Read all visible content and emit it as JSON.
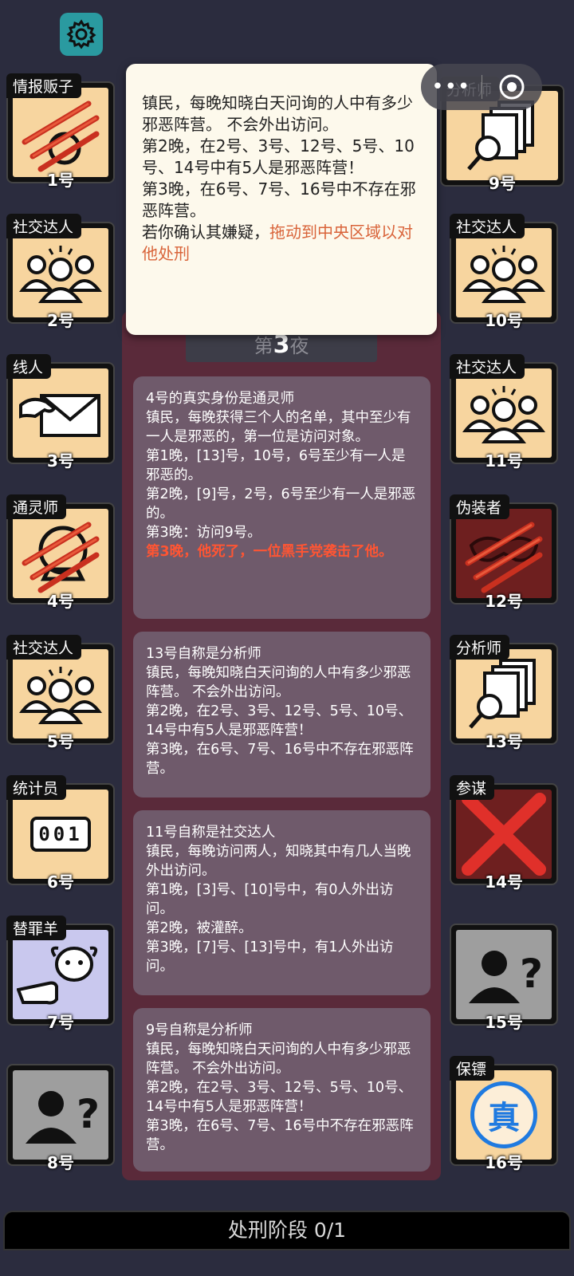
{
  "popup": {
    "text": "镇民，每晚知晓白天问询的人中有多少邪恶阵营。 不会外出访问。\n第2晚，在2号、3号、12号、5号、10号、14号中有5人是邪恶阵营！\n第3晚，在6号、7号、16号中不存在邪恶阵营。\n若你确认其嫌疑，",
    "highlight": "拖动到中央区域以对他处刑"
  },
  "night": {
    "prefix": "第",
    "num": "3",
    "suffix": "夜"
  },
  "cards": [
    {
      "role": "情报贩子",
      "num": "1号"
    },
    {
      "role": "社交达人",
      "num": "2号"
    },
    {
      "role": "线人",
      "num": "3号"
    },
    {
      "role": "通灵师",
      "num": "4号"
    },
    {
      "role": "社交达人",
      "num": "5号"
    },
    {
      "role": "统计员",
      "num": "6号"
    },
    {
      "role": "替罪羊",
      "num": "7号"
    },
    {
      "role": "",
      "num": "8号"
    },
    {
      "role": "分析师",
      "num": "9号"
    },
    {
      "role": "社交达人",
      "num": "10号"
    },
    {
      "role": "社交达人",
      "num": "11号"
    },
    {
      "role": "伪装者",
      "num": "12号"
    },
    {
      "role": "分析师",
      "num": "13号"
    },
    {
      "role": "参谋",
      "num": "14号"
    },
    {
      "role": "",
      "num": "15号"
    },
    {
      "role": "保镖",
      "num": "16号"
    }
  ],
  "logs": [
    {
      "text": "4号的真实身份是通灵师\n镇民，每晚获得三个人的名单，其中至少有一人是邪恶的，第一位是访问对象。\n第1晚，[13]号，10号，6号至少有一人是邪恶的。\n第2晚，[9]号，2号，6号至少有一人是邪恶的。\n第3晚：访问9号。",
      "red": "第3晚，他死了，一位黑手党袭击了他。"
    },
    {
      "text": "13号自称是分析师\n镇民，每晚知晓白天问询的人中有多少邪恶阵营。 不会外出访问。\n第2晚，在2号、3号、12号、5号、10号、14号中有5人是邪恶阵营！\n第3晚，在6号、7号、16号中不存在邪恶阵营。",
      "red": ""
    },
    {
      "text": "11号自称是社交达人\n镇民，每晚访问两人，知晓其中有几人当晚外出访问。\n第1晚，[3]号、[10]号中，有0人外出访问。\n第2晚，被灌醉。\n第3晚，[7]号、[13]号中，有1人外出访问。",
      "red": ""
    },
    {
      "text": "9号自称是分析师\n镇民，每晚知晓白天问询的人中有多少邪恶阵营。 不会外出访问。\n第2晚，在2号、3号、12号、5号、10号、14号中有5人是邪恶阵营！\n第3晚，在6号、7号、16号中不存在邪恶阵营。",
      "red": ""
    }
  ],
  "guard_badge": "真",
  "counter_digits": "001",
  "bottom": {
    "label": "处刑阶段 0/1"
  },
  "colors": {
    "accent_red": "#ff5533",
    "highlight": "#d9643a",
    "card_bg": "#f7d59f"
  }
}
